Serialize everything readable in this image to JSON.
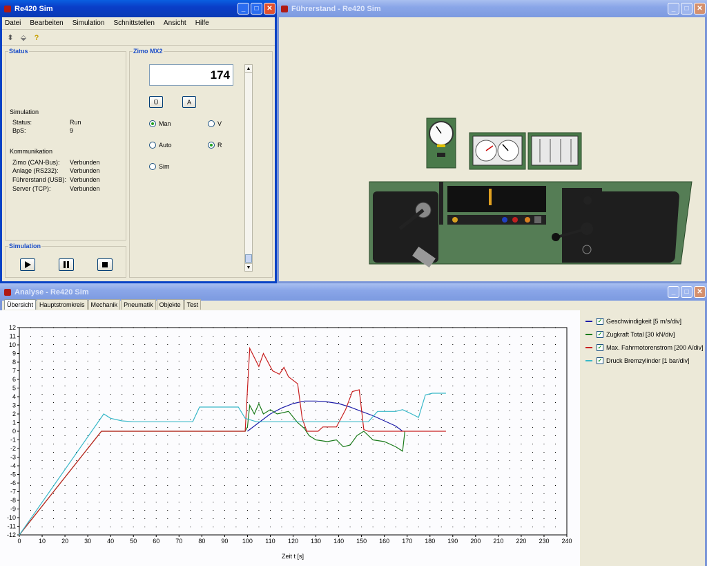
{
  "windows": {
    "sim": {
      "title": "Re420 Sim"
    },
    "cab": {
      "title": "Führerstand - Re420 Sim"
    },
    "analysis": {
      "title": "Analyse - Re420 Sim"
    }
  },
  "menu": [
    "Datei",
    "Bearbeiten",
    "Simulation",
    "Schnittstellen",
    "Ansicht",
    "Hilfe"
  ],
  "toolbar_icons": [
    "connect-icon",
    "disconnect-icon",
    "help-icon"
  ],
  "status_group": {
    "label": "Status",
    "simulation_heading": "Simulation",
    "simulation_rows": [
      {
        "key": "Status:",
        "value": "Run"
      },
      {
        "key": "BpS:",
        "value": "9"
      }
    ],
    "comm_heading": "Kommunikation",
    "comm_rows": [
      {
        "key": "Zimo (CAN-Bus):",
        "value": "Verbunden"
      },
      {
        "key": "Anlage (RS232):",
        "value": "Verbunden"
      },
      {
        "key": "Führerstand (USB):",
        "value": "Verbunden"
      },
      {
        "key": "Server (TCP):",
        "value": "Verbunden"
      }
    ]
  },
  "sim_group": {
    "label": "Simulation",
    "buttons": [
      "play",
      "pause",
      "stop"
    ]
  },
  "zimo": {
    "label": "Zimo MX2",
    "display_value": "174",
    "btn_u": "Ü",
    "btn_a": "A",
    "radios": [
      {
        "label": "Man",
        "checked": true
      },
      {
        "label": "V",
        "checked": false
      },
      {
        "label": "Auto",
        "checked": false
      },
      {
        "label": "R",
        "checked": true
      },
      {
        "label": "Sim",
        "checked": false
      }
    ]
  },
  "tabs": [
    "Übersicht",
    "Hauptstromkreis",
    "Mechanik",
    "Pneumatik",
    "Objekte",
    "Test"
  ],
  "chart_data": {
    "type": "line",
    "xlabel": "Zeit t  [s]",
    "xlim": [
      0,
      240
    ],
    "ylim": [
      -12,
      12
    ],
    "x_ticks": [
      0,
      10,
      20,
      30,
      40,
      50,
      60,
      70,
      80,
      90,
      100,
      110,
      120,
      130,
      140,
      150,
      160,
      170,
      180,
      190,
      200,
      210,
      220,
      230,
      240
    ],
    "y_ticks": [
      -12,
      -11,
      -10,
      -9,
      -8,
      -7,
      -6,
      -5,
      -4,
      -3,
      -2,
      -1,
      0,
      1,
      2,
      3,
      4,
      5,
      6,
      7,
      8,
      9,
      10,
      11,
      12
    ],
    "grid": true,
    "legend_position": "right",
    "series": [
      {
        "name": "Geschwindigkeit [5 m/s/div]",
        "color": "#1c1ca8",
        "points": [
          [
            100,
            0
          ],
          [
            105,
            1
          ],
          [
            110,
            2
          ],
          [
            115,
            2.7
          ],
          [
            120,
            3.2
          ],
          [
            125,
            3.5
          ],
          [
            130,
            3.5
          ],
          [
            135,
            3.4
          ],
          [
            140,
            3.2
          ],
          [
            145,
            2.8
          ],
          [
            150,
            2.3
          ],
          [
            155,
            1.8
          ],
          [
            160,
            1.2
          ],
          [
            165,
            0.6
          ],
          [
            168,
            0
          ]
        ]
      },
      {
        "name": "Zugkraft Total [30 kN/div]",
        "color": "#1a7a1a",
        "points": [
          [
            0,
            -12
          ],
          [
            36,
            0
          ],
          [
            99,
            0
          ],
          [
            100,
            0.5
          ],
          [
            101,
            3
          ],
          [
            103,
            2
          ],
          [
            105,
            3.2
          ],
          [
            107,
            2
          ],
          [
            110,
            2.5
          ],
          [
            113,
            2
          ],
          [
            118,
            2.3
          ],
          [
            122,
            1
          ],
          [
            125,
            0.3
          ],
          [
            127,
            -0.5
          ],
          [
            130,
            -1
          ],
          [
            135,
            -1.2
          ],
          [
            139,
            -1
          ],
          [
            142,
            -1.8
          ],
          [
            145,
            -1.6
          ],
          [
            148,
            -0.5
          ],
          [
            151,
            0
          ],
          [
            155,
            -1
          ],
          [
            160,
            -1.2
          ],
          [
            165,
            -1.8
          ],
          [
            168,
            -2.3
          ],
          [
            169,
            0
          ]
        ]
      },
      {
        "name": "Max. Fahrmotorenstrom [200 A/div]",
        "color": "#c82020",
        "points": [
          [
            0,
            -12
          ],
          [
            36,
            0
          ],
          [
            99,
            0
          ],
          [
            101,
            9.6
          ],
          [
            105,
            7.5
          ],
          [
            107,
            9
          ],
          [
            111,
            7
          ],
          [
            114,
            6.6
          ],
          [
            116,
            7.4
          ],
          [
            118,
            6.3
          ],
          [
            122,
            5.5
          ],
          [
            124,
            1.5
          ],
          [
            126,
            0
          ],
          [
            131,
            0
          ],
          [
            133,
            0.5
          ],
          [
            139,
            0.5
          ],
          [
            143,
            2.5
          ],
          [
            146,
            4.6
          ],
          [
            149,
            4.8
          ],
          [
            151,
            0.2
          ],
          [
            153,
            0
          ],
          [
            187,
            0
          ]
        ]
      },
      {
        "name": "Druck Bremzylinder [1 bar/div]",
        "color": "#38b8c8",
        "points": [
          [
            0,
            -12
          ],
          [
            37,
            2
          ],
          [
            40,
            1.5
          ],
          [
            45,
            1.2
          ],
          [
            50,
            1.1
          ],
          [
            76,
            1.1
          ],
          [
            79,
            2.8
          ],
          [
            96,
            2.8
          ],
          [
            99,
            1.5
          ],
          [
            104,
            1.1
          ],
          [
            153,
            1.1
          ],
          [
            157,
            2.3
          ],
          [
            165,
            2.3
          ],
          [
            168,
            2.5
          ],
          [
            172,
            2
          ],
          [
            175,
            1.6
          ],
          [
            178,
            4.2
          ],
          [
            181,
            4.4
          ],
          [
            187,
            4.4
          ]
        ]
      }
    ]
  }
}
